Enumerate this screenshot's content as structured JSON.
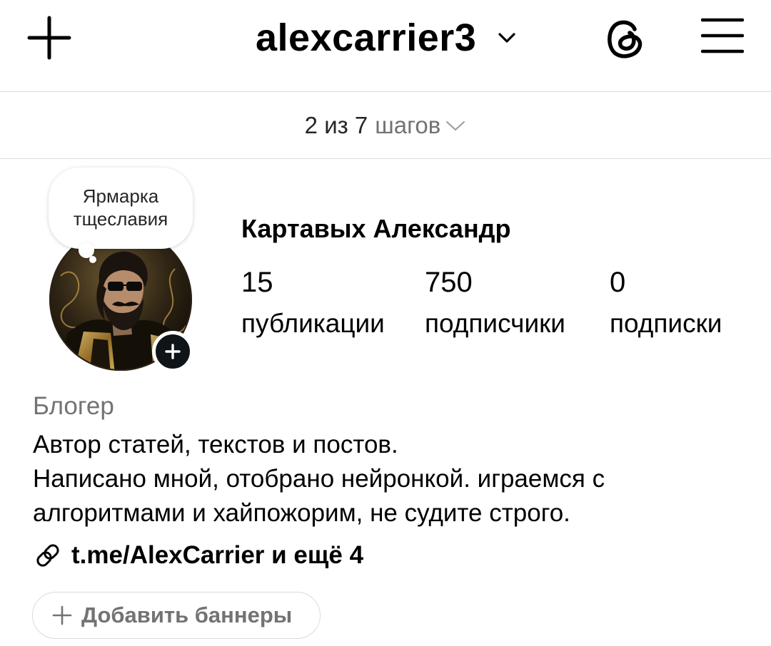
{
  "header": {
    "username": "alexcarrier3",
    "icons": {
      "create": "plus-icon",
      "account_switch": "chevron-down-icon",
      "threads": "threads-icon",
      "menu": "hamburger-menu-icon"
    }
  },
  "onboarding": {
    "steps_done": "2 из 7",
    "steps_word": "шагов"
  },
  "profile": {
    "note": "Ярмарка тщеславия",
    "full_name": "Картавых Александр",
    "stats": [
      {
        "value": "15",
        "label": "публикации"
      },
      {
        "value": "750",
        "label": "подписчики"
      },
      {
        "value": "0",
        "label": "подписки"
      }
    ],
    "category": "Блогер",
    "bio_lines": [
      "Автор статей, текстов и постов.",
      "Написано мной, отобрано нейронкой. играемся с",
      "алгоритмами и хайпожорим, не судите строго."
    ],
    "link": "t.me/AlexCarrier и ещё 4",
    "add_banners_label": "Добавить баннеры"
  },
  "colors": {
    "text_primary": "#000000",
    "text_secondary": "#737373",
    "divider": "#dbdbdb",
    "add_story_badge": "#0f1419"
  }
}
